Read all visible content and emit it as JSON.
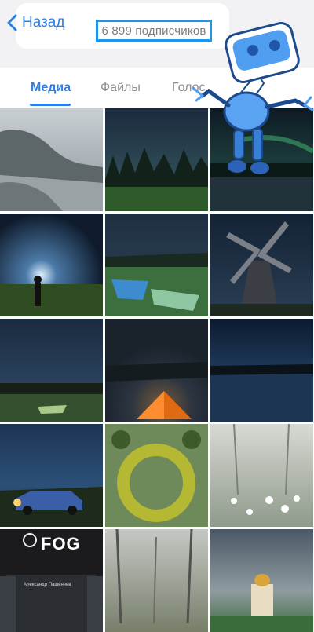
{
  "header": {
    "back_label": "Назад",
    "subscribers": "6 899 подписчиков"
  },
  "tabs": [
    {
      "label": "Медиа",
      "active": true
    },
    {
      "label": "Файлы",
      "active": false
    },
    {
      "label": "Голос",
      "active": false
    }
  ],
  "media": {
    "poster_title": "FOG",
    "poster_author": "Александр Пашенчев"
  },
  "colors": {
    "accent": "#2f7ee6",
    "highlight_border": "#1b98ee"
  },
  "icons": [
    "chevron-left-icon",
    "robot-sticker"
  ]
}
